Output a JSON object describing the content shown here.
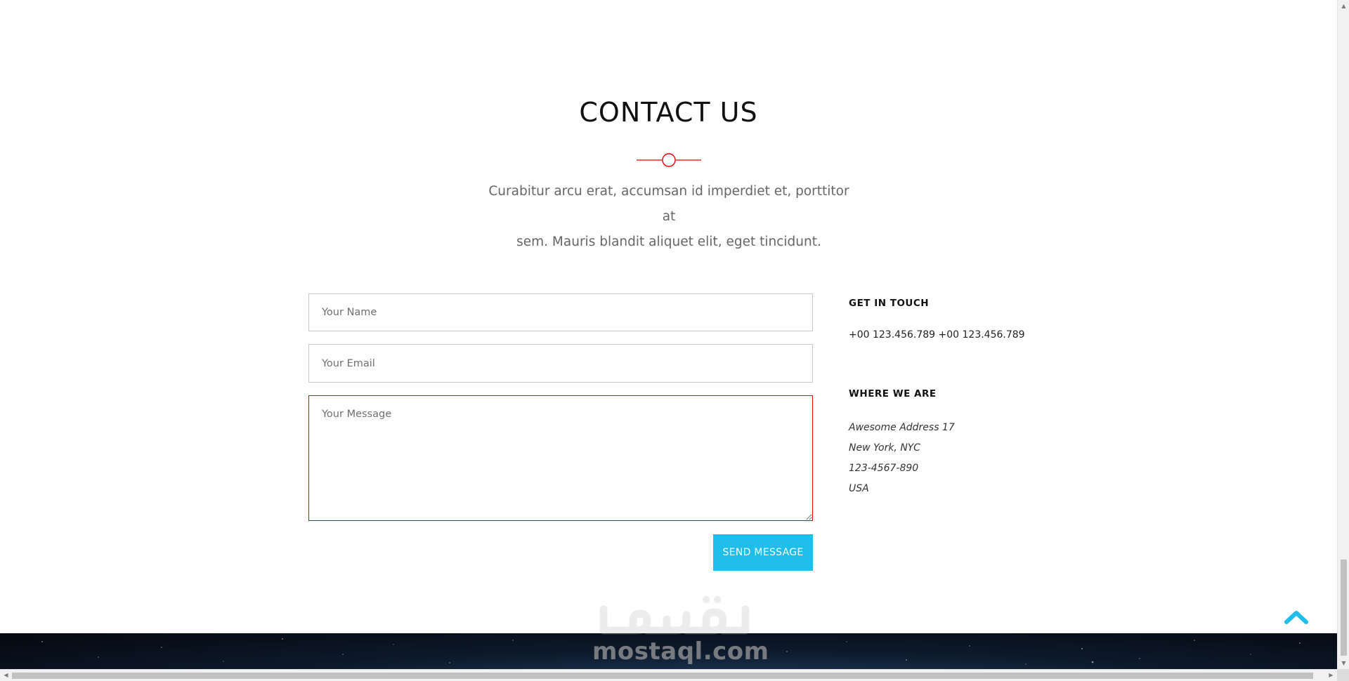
{
  "section": {
    "title": "CONTACT US",
    "lead_line_1": "Curabitur arcu erat, accumsan id imperdiet et, porttitor at",
    "lead_line_2": "sem. Mauris blandit aliquet elit, eget tincidunt."
  },
  "form": {
    "name_placeholder": "Your Name",
    "email_placeholder": "Your Email",
    "message_placeholder": "Your Message",
    "submit_label": "SEND MESSAGE"
  },
  "contact_info": {
    "get_in_touch_heading": "GET IN TOUCH",
    "phone": "+00 123.456.789 +00 123.456.789",
    "where_heading": "WHERE WE ARE",
    "address": [
      "Awesome Address 17",
      "New York, NYC",
      "123-4567-890",
      "USA"
    ]
  },
  "watermark": {
    "arabic": "مستقل",
    "latin": "mostaql.com"
  },
  "icons": {
    "divider": "circle-divider-icon",
    "scroll_top": "chevron-up-icon"
  },
  "colors": {
    "accent_red": "#e60000",
    "button_blue": "#1fbde9",
    "footer_dark": "#05080f"
  }
}
